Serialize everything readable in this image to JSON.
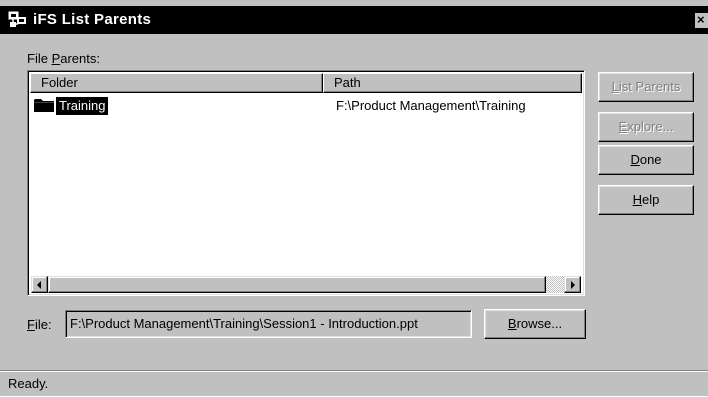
{
  "window": {
    "title": "iFS List Parents",
    "close_glyph": "×"
  },
  "parents_label": {
    "prefix": "File ",
    "accel": "P",
    "suffix": "arents:"
  },
  "list": {
    "columns": [
      "Folder",
      "Path"
    ],
    "rows": [
      {
        "icon": "folder-icon",
        "folder": "Training",
        "path": "F:\\Product Management\\Training",
        "selected": true
      }
    ]
  },
  "buttons": {
    "list_parents": {
      "accel": "L",
      "rest": "ist Parents",
      "enabled": false
    },
    "explore": {
      "accel": "E",
      "rest": "xplore...",
      "enabled": false
    },
    "done": {
      "accel": "D",
      "rest": "one",
      "enabled": true
    },
    "help": {
      "accel": "H",
      "rest": "elp",
      "enabled": true
    },
    "browse": {
      "accel": "B",
      "rest": "rowse...",
      "enabled": true
    }
  },
  "file_field": {
    "label_accel": "F",
    "label_rest": "ile:",
    "value": "F:\\Product Management\\Training\\Session1 - Introduction.ppt"
  },
  "status": {
    "text": "Ready."
  },
  "colors": {
    "face": "#c0c0c0",
    "titlebar": "#000000",
    "selection": "#000000",
    "disabled_text": "#808080"
  }
}
